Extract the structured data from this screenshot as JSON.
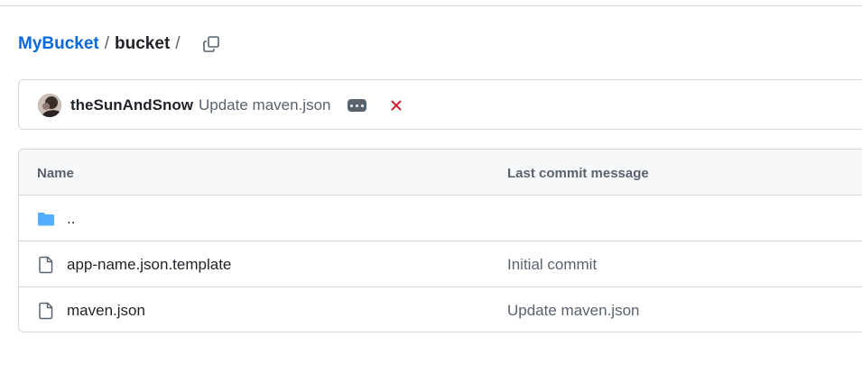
{
  "breadcrumb": {
    "root": "MyBucket",
    "separator": "/",
    "current": "bucket",
    "trailing_separator": "/",
    "copy_icon": "copy-icon"
  },
  "latest_commit": {
    "author": "theSunAndSnow",
    "message": "Update maven.json",
    "more_icon": "ellipsis-icon",
    "status_icon": "x-icon",
    "status_color": "#cf222e"
  },
  "file_table": {
    "headers": {
      "name": "Name",
      "last_commit": "Last commit message"
    },
    "rows": [
      {
        "name": "..",
        "type": "folder",
        "icon": "folder-icon",
        "commit": ""
      },
      {
        "name": "app-name.json.template",
        "type": "file",
        "icon": "file-icon",
        "commit": "Initial commit"
      },
      {
        "name": "maven.json",
        "type": "file",
        "icon": "file-icon",
        "commit": "Update maven.json"
      }
    ]
  },
  "colors": {
    "link": "#0969da",
    "folder": "#54aeff",
    "muted": "#59636e",
    "border": "#d0d7de"
  }
}
